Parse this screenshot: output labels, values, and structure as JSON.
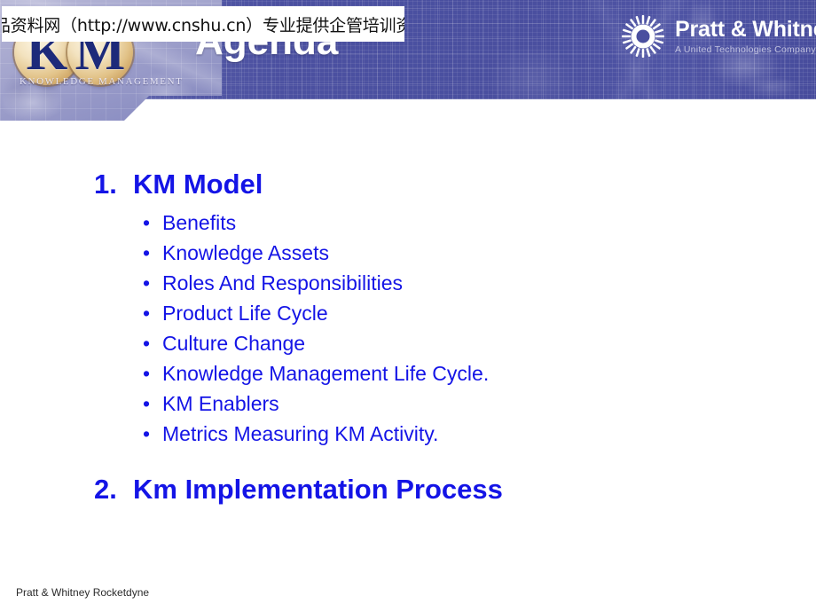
{
  "slide": {
    "title": "Agenda",
    "footer": "Pratt & Whitney Rocketdyne"
  },
  "watermark": {
    "text": "精品资料网（http://www.cnshu.cn）专业提供企管培训资料"
  },
  "brand": {
    "km_logo": {
      "letter_k": "K",
      "letter_m": "M",
      "tagline": "KNOWLEDGE MANAGEMENT"
    },
    "pratt_whitney": {
      "name": "Pratt & Whitney",
      "tagline": "A United Technologies Company"
    }
  },
  "outline": {
    "items": [
      {
        "number": "1.",
        "label": "KM Model"
      },
      {
        "number": "2.",
        "label": "Km Implementation Process"
      }
    ],
    "bullets": [
      "Benefits",
      "Knowledge Assets",
      "Roles And Responsibilities",
      "Product Life Cycle",
      "Culture Change",
      "Knowledge Management Life Cycle.",
      "KM Enablers",
      "Metrics Measuring KM Activity."
    ],
    "bullet_glyph": "•"
  },
  "colors": {
    "header_blue": "#4a4f9f",
    "text_blue": "#1414e6",
    "title_white": "#ffffff",
    "coin_gold": "#e2c389"
  }
}
